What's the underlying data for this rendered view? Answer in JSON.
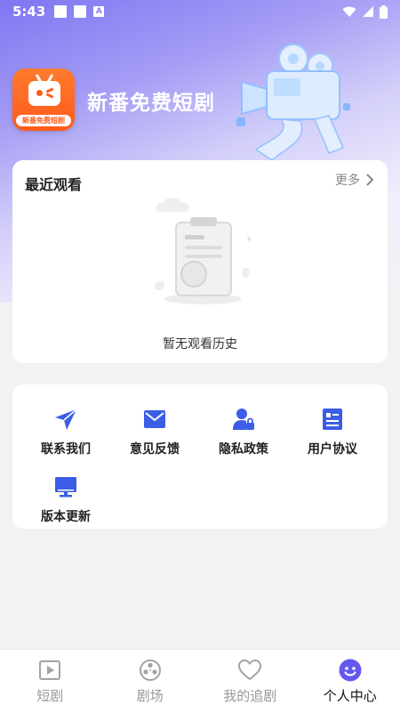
{
  "status_bar": {
    "time": "5:43",
    "notif_letter": "A"
  },
  "app": {
    "name": "新番免费短剧",
    "logo_caption": "新番免费短剧"
  },
  "recent": {
    "title": "最近观看",
    "more_label": "更多",
    "empty_text": "暂无观看历史"
  },
  "menu": {
    "items": [
      {
        "label": "联系我们",
        "icon": "send-icon"
      },
      {
        "label": "意见反馈",
        "icon": "mail-icon"
      },
      {
        "label": "隐私政策",
        "icon": "user-lock-icon"
      },
      {
        "label": "用户协议",
        "icon": "document-icon"
      },
      {
        "label": "版本更新",
        "icon": "monitor-icon"
      }
    ]
  },
  "tabbar": {
    "tabs": [
      {
        "label": "短剧",
        "icon": "play-square-icon",
        "active": false
      },
      {
        "label": "剧场",
        "icon": "film-reel-icon",
        "active": false
      },
      {
        "label": "我的追剧",
        "icon": "heart-icon",
        "active": false
      },
      {
        "label": "个人中心",
        "icon": "smiley-icon",
        "active": true
      }
    ]
  },
  "colors": {
    "accent": "#3b5de7",
    "tab_active": "#6457f0",
    "tab_inactive": "#a3a3a3",
    "logo_orange": "#ff5a1a"
  }
}
